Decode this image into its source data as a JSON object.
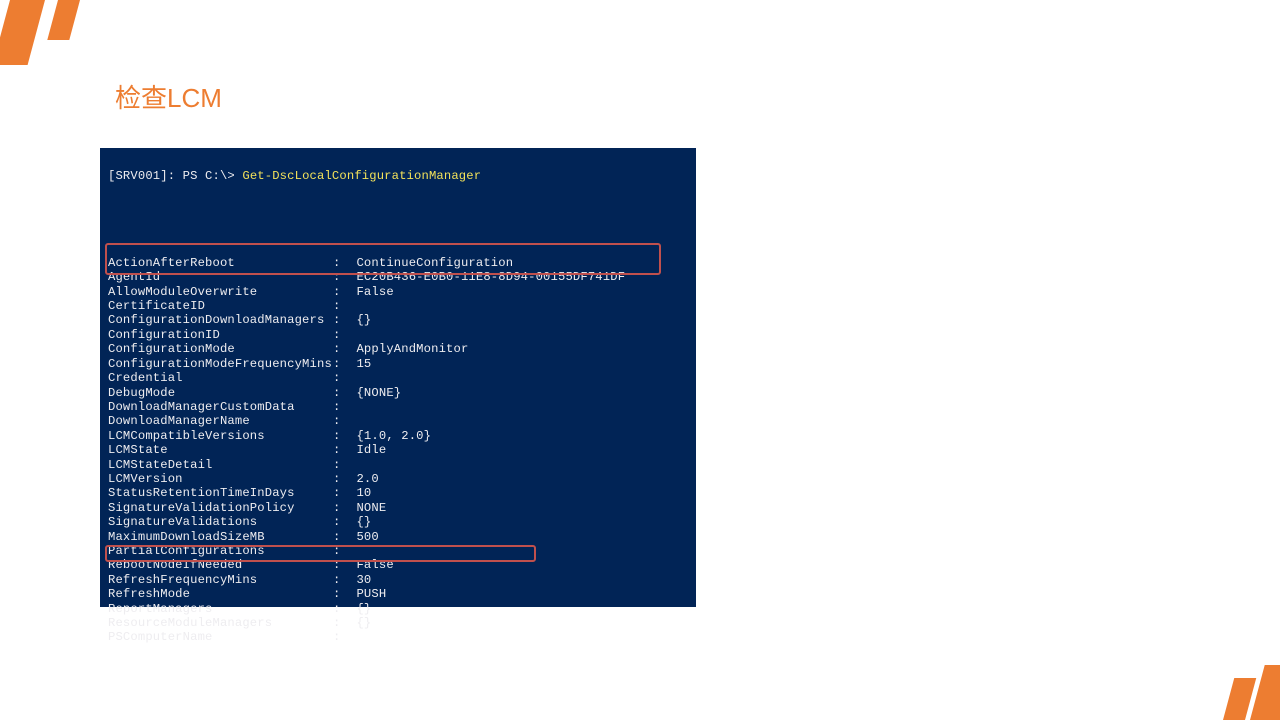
{
  "title": "检查LCM",
  "prompt_prefix": "[SRV001]: PS C:\\> ",
  "prompt_command": "Get-DscLocalConfigurationManager",
  "rows": [
    {
      "k": "ActionAfterReboot",
      "v": "ContinueConfiguration"
    },
    {
      "k": "AgentId",
      "v": "EC20B436-E0B0-11E8-8D94-00155DF741DF"
    },
    {
      "k": "AllowModuleOverwrite",
      "v": "False"
    },
    {
      "k": "CertificateID",
      "v": ""
    },
    {
      "k": "ConfigurationDownloadManagers",
      "v": "{}"
    },
    {
      "k": "ConfigurationID",
      "v": ""
    },
    {
      "k": "ConfigurationMode",
      "v": "ApplyAndMonitor"
    },
    {
      "k": "ConfigurationModeFrequencyMins",
      "v": "15"
    },
    {
      "k": "Credential",
      "v": ""
    },
    {
      "k": "DebugMode",
      "v": "{NONE}"
    },
    {
      "k": "DownloadManagerCustomData",
      "v": ""
    },
    {
      "k": "DownloadManagerName",
      "v": ""
    },
    {
      "k": "LCMCompatibleVersions",
      "v": "{1.0, 2.0}"
    },
    {
      "k": "LCMState",
      "v": "Idle"
    },
    {
      "k": "LCMStateDetail",
      "v": ""
    },
    {
      "k": "LCMVersion",
      "v": "2.0"
    },
    {
      "k": "StatusRetentionTimeInDays",
      "v": "10"
    },
    {
      "k": "SignatureValidationPolicy",
      "v": "NONE"
    },
    {
      "k": "SignatureValidations",
      "v": "{}"
    },
    {
      "k": "MaximumDownloadSizeMB",
      "v": "500"
    },
    {
      "k": "PartialConfigurations",
      "v": ""
    },
    {
      "k": "RebootNodeIfNeeded",
      "v": "False"
    },
    {
      "k": "RefreshFrequencyMins",
      "v": "30"
    },
    {
      "k": "RefreshMode",
      "v": "PUSH"
    },
    {
      "k": "ReportManagers",
      "v": "{}"
    },
    {
      "k": "ResourceModuleManagers",
      "v": "{}"
    },
    {
      "k": "PSComputerName",
      "v": ""
    }
  ]
}
